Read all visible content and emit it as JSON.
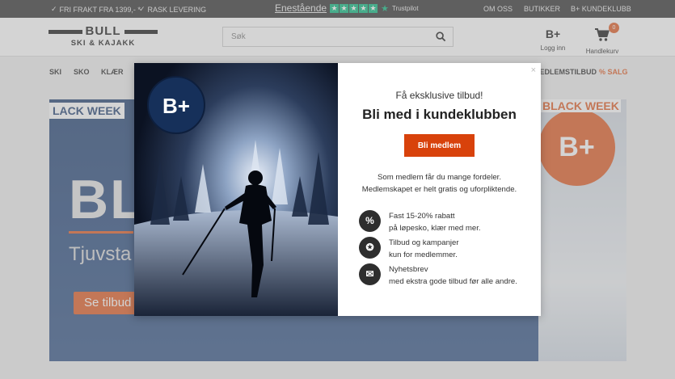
{
  "topbar": {
    "usp": [
      "FRI FRAKT FRA 1399,- *",
      "RASK LEVERING"
    ],
    "trustpilot": {
      "word": "Enestående",
      "label": "Trustpilot",
      "stars": 5,
      "color": "#00b67a"
    },
    "links": [
      "OM OSS",
      "BUTIKKER",
      "B+ KUNDEKLUBB"
    ]
  },
  "header": {
    "logo": {
      "main": "BULL",
      "sub": "SKI & KAJAKK"
    },
    "search": {
      "placeholder": "Søk",
      "icon": "search-icon"
    },
    "login": {
      "icon_text": "B+",
      "label": "Logg inn"
    },
    "cart": {
      "icon": "cart-icon",
      "count": "0",
      "label": "Handlekurv"
    }
  },
  "nav": {
    "items": [
      "SKI",
      "SKO",
      "KLÆR"
    ],
    "right_items": [
      "MEDLEMSTILBUD",
      "% SALG"
    ]
  },
  "banner": {
    "tag": "LACK WEEK",
    "headline": "BL",
    "subline": "Tjuvsta",
    "button": "Se tilbud",
    "tag_right": "BLACK WEEK",
    "circle": "B+"
  },
  "modal": {
    "badge": "B+",
    "close": "×",
    "kicker": "Få eksklusive tilbud!",
    "title": "Bli med i kundeklubben",
    "button": "Bli medlem",
    "desc_line1": "Som medlem får du mange fordeler.",
    "desc_line2": "Medlemskapet er helt gratis og uforpliktende.",
    "perks": [
      {
        "icon": "percent-icon",
        "glyph": "%",
        "line1": "Fast 15-20% rabatt",
        "line2": "på løpesko, klær med mer."
      },
      {
        "icon": "award-icon",
        "glyph": "✪",
        "line1": "Tilbud og kampanjer",
        "line2": "kun for medlemmer."
      },
      {
        "icon": "newsletter-icon",
        "glyph": "✉",
        "line1": "Nyhetsbrev",
        "line2": "med ekstra gode tilbud før alle andre."
      }
    ]
  },
  "colors": {
    "accent": "#e0561c",
    "button": "#d8420b",
    "dark": "#2b2b2b",
    "navy": "#1a3b6e"
  }
}
